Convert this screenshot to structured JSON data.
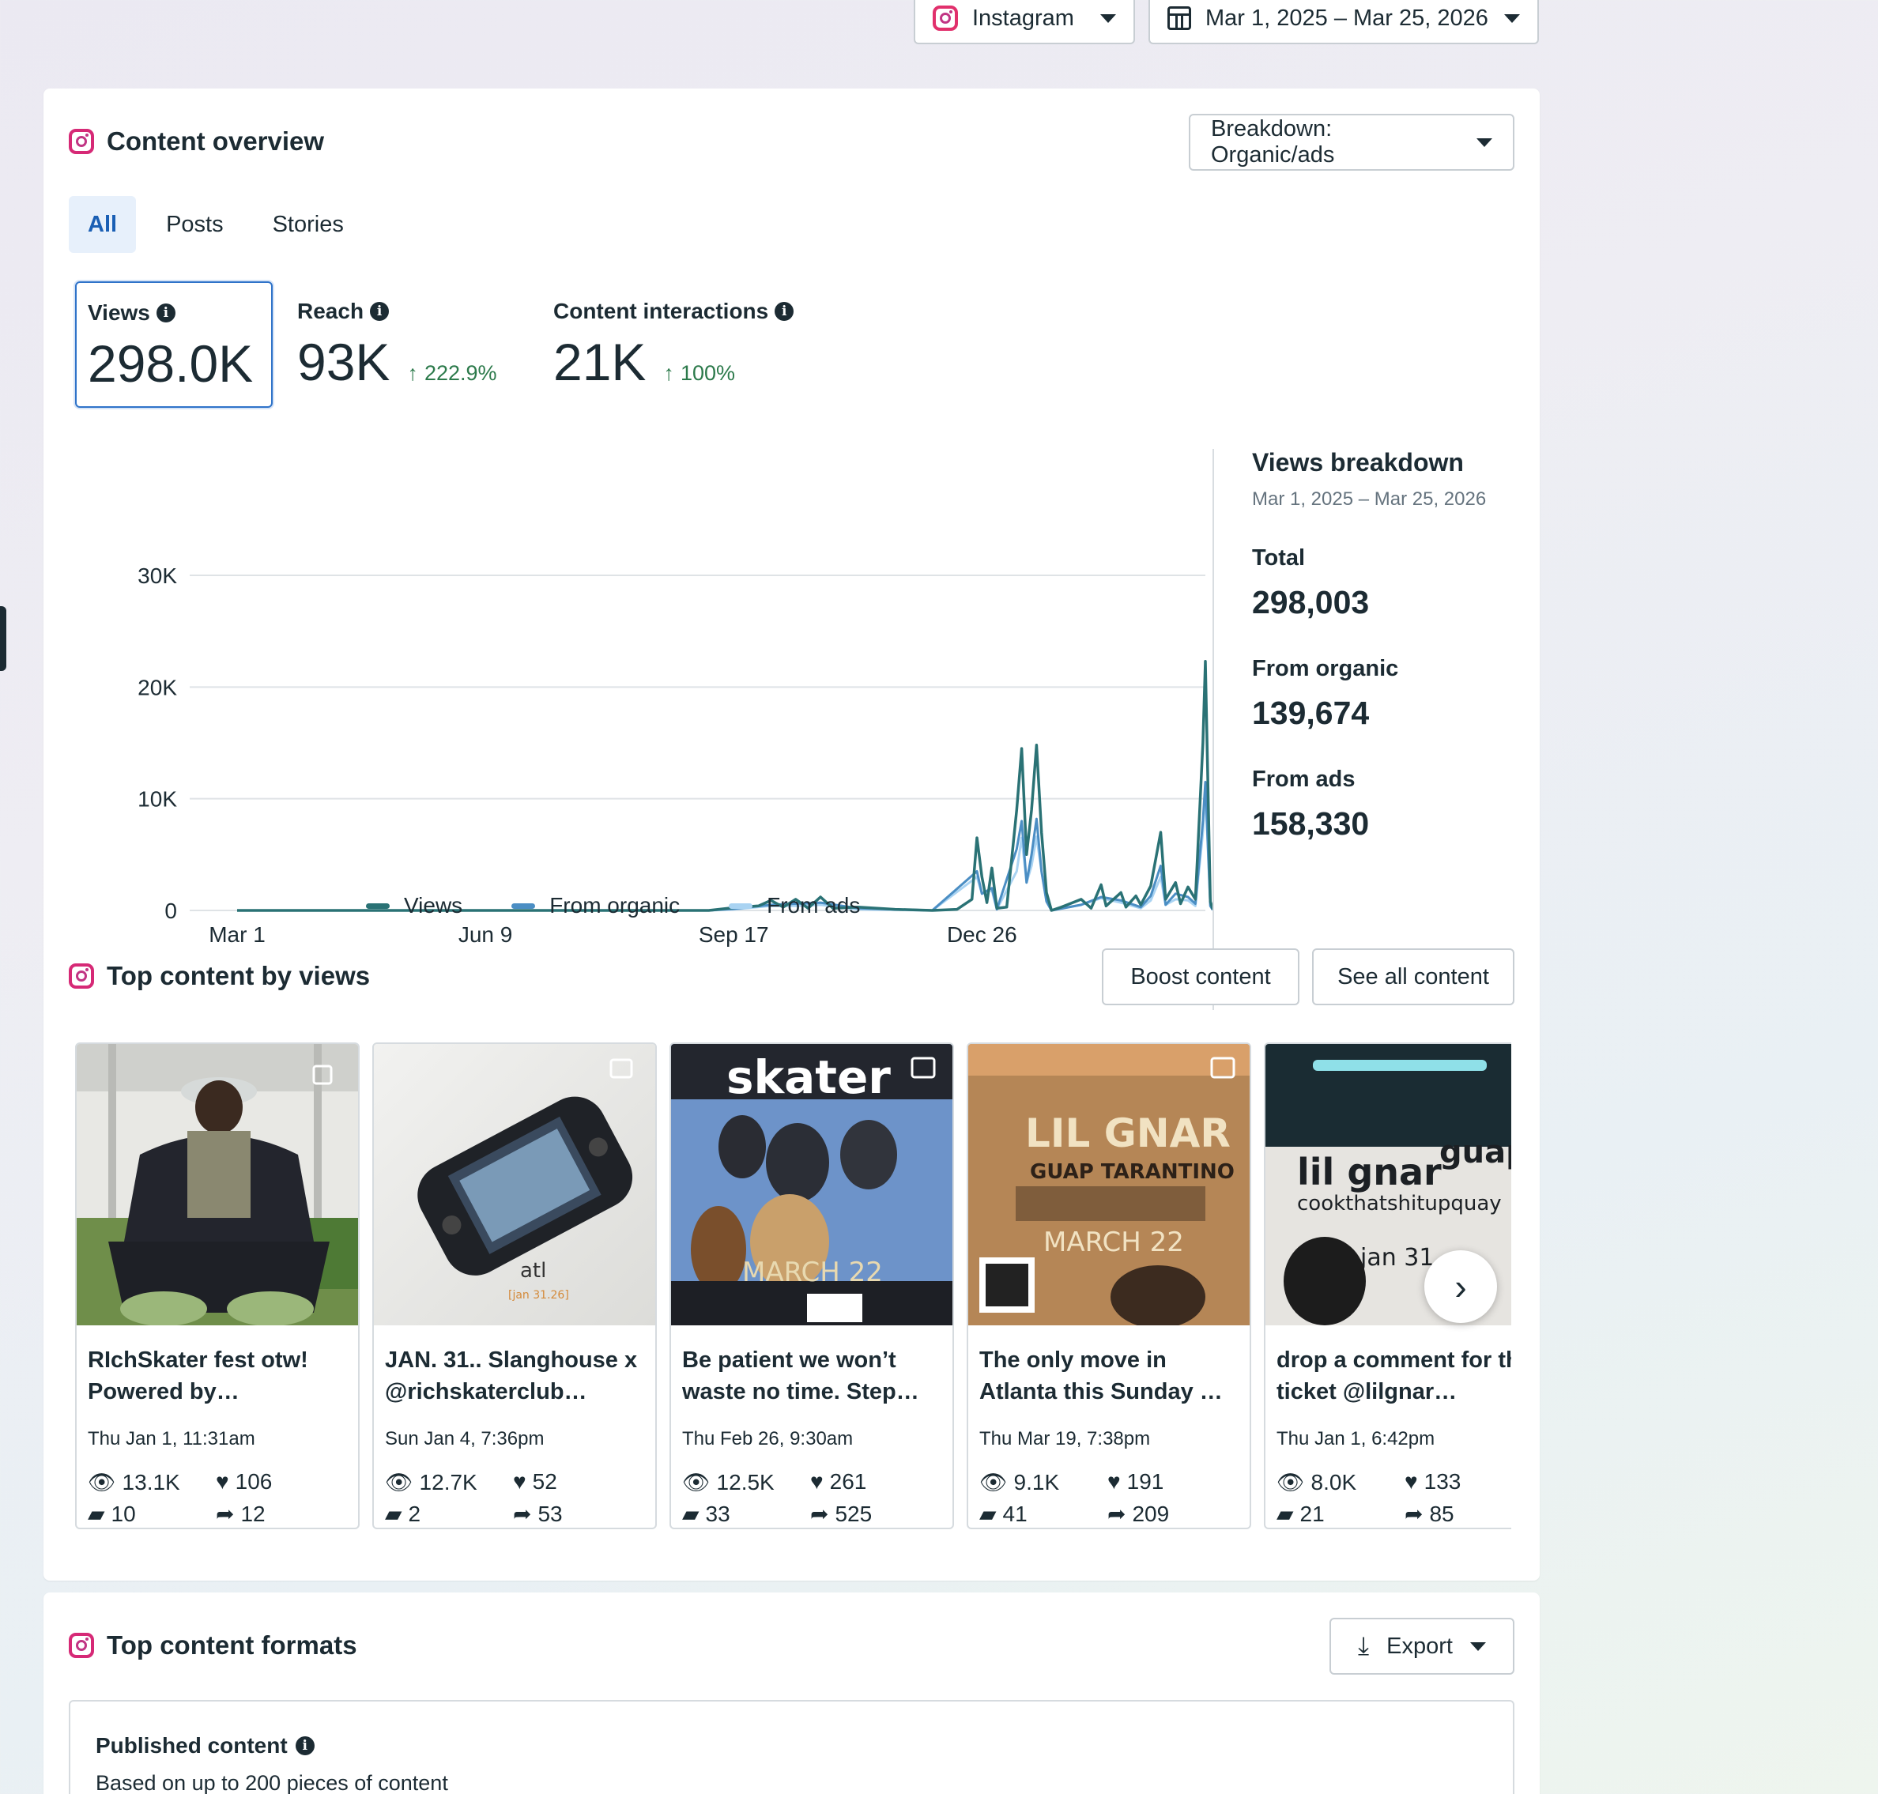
{
  "header": {
    "platform": "Instagram",
    "date_range": "Mar 1, 2025 – Mar 25, 2026"
  },
  "overview": {
    "title": "Content overview",
    "breakdown_button": "Breakdown: Organic/ads",
    "tabs": [
      {
        "label": "All",
        "active": true
      },
      {
        "label": "Posts",
        "active": false
      },
      {
        "label": "Stories",
        "active": false
      }
    ],
    "metrics": [
      {
        "label": "Views",
        "value": "298.0K",
        "delta": ""
      },
      {
        "label": "Reach",
        "value": "93K",
        "delta": "222.9%"
      },
      {
        "label": "Content interactions",
        "value": "21K",
        "delta": "100%"
      }
    ]
  },
  "colors": {
    "views": "#2a7275",
    "organic": "#4b8ec4",
    "ads": "#a9d3f2",
    "accent": "#2f73c9",
    "positive": "#2c7a4b"
  },
  "chart_data": {
    "type": "line",
    "x_ticks": [
      "Mar 1",
      "Jun 9",
      "Sep 17",
      "Dec 26"
    ],
    "y_ticks": [
      "0",
      "10K",
      "20K",
      "30K"
    ],
    "ylim": [
      0,
      30000
    ],
    "xlim": [
      0,
      390
    ],
    "grid": true,
    "legend_position": "bottom",
    "series": [
      {
        "name": "Views",
        "points": [
          [
            0,
            0
          ],
          [
            190,
            0
          ],
          [
            200,
            250
          ],
          [
            210,
            400
          ],
          [
            215,
            900
          ],
          [
            220,
            300
          ],
          [
            225,
            1000
          ],
          [
            230,
            200
          ],
          [
            235,
            1200
          ],
          [
            240,
            200
          ],
          [
            250,
            300
          ],
          [
            265,
            100
          ],
          [
            280,
            0
          ],
          [
            290,
            100
          ],
          [
            296,
            1000
          ],
          [
            298,
            6500
          ],
          [
            300,
            3000
          ],
          [
            302,
            700
          ],
          [
            304,
            3800
          ],
          [
            306,
            200
          ],
          [
            310,
            300
          ],
          [
            314,
            9000
          ],
          [
            316,
            14500
          ],
          [
            318,
            5000
          ],
          [
            320,
            9000
          ],
          [
            322,
            14800
          ],
          [
            324,
            7000
          ],
          [
            326,
            1600
          ],
          [
            328,
            0
          ],
          [
            332,
            300
          ],
          [
            340,
            1000
          ],
          [
            344,
            200
          ],
          [
            348,
            2300
          ],
          [
            350,
            400
          ],
          [
            356,
            1600
          ],
          [
            358,
            300
          ],
          [
            362,
            1300
          ],
          [
            364,
            500
          ],
          [
            368,
            2200
          ],
          [
            372,
            7000
          ],
          [
            374,
            1000
          ],
          [
            378,
            2500
          ],
          [
            380,
            600
          ],
          [
            383,
            2100
          ],
          [
            386,
            1000
          ],
          [
            389,
            15000
          ],
          [
            390,
            22300
          ],
          [
            392,
            800
          ],
          [
            393,
            100
          ]
        ]
      },
      {
        "name": "From organic",
        "points": [
          [
            0,
            0
          ],
          [
            190,
            0
          ],
          [
            200,
            150
          ],
          [
            215,
            500
          ],
          [
            225,
            600
          ],
          [
            235,
            700
          ],
          [
            250,
            200
          ],
          [
            280,
            0
          ],
          [
            298,
            3500
          ],
          [
            300,
            1500
          ],
          [
            304,
            2000
          ],
          [
            306,
            100
          ],
          [
            314,
            5500
          ],
          [
            316,
            8000
          ],
          [
            318,
            2500
          ],
          [
            320,
            5000
          ],
          [
            322,
            8200
          ],
          [
            324,
            3500
          ],
          [
            326,
            800
          ],
          [
            328,
            0
          ],
          [
            340,
            500
          ],
          [
            348,
            1200
          ],
          [
            356,
            900
          ],
          [
            364,
            300
          ],
          [
            368,
            1300
          ],
          [
            372,
            4000
          ],
          [
            374,
            500
          ],
          [
            378,
            1500
          ],
          [
            383,
            1200
          ],
          [
            386,
            600
          ],
          [
            389,
            8000
          ],
          [
            390,
            11500
          ],
          [
            392,
            400
          ],
          [
            393,
            50
          ]
        ]
      },
      {
        "name": "From ads",
        "points": [
          [
            0,
            0
          ],
          [
            190,
            0
          ],
          [
            200,
            100
          ],
          [
            215,
            400
          ],
          [
            225,
            400
          ],
          [
            235,
            500
          ],
          [
            250,
            100
          ],
          [
            280,
            0
          ],
          [
            298,
            3000
          ],
          [
            300,
            1500
          ],
          [
            304,
            1800
          ],
          [
            306,
            100
          ],
          [
            314,
            3500
          ],
          [
            316,
            6500
          ],
          [
            318,
            2500
          ],
          [
            320,
            4000
          ],
          [
            322,
            6600
          ],
          [
            324,
            3500
          ],
          [
            326,
            800
          ],
          [
            328,
            0
          ],
          [
            340,
            500
          ],
          [
            348,
            1100
          ],
          [
            356,
            700
          ],
          [
            364,
            200
          ],
          [
            368,
            900
          ],
          [
            372,
            3000
          ],
          [
            374,
            500
          ],
          [
            378,
            1000
          ],
          [
            383,
            900
          ],
          [
            386,
            400
          ],
          [
            389,
            7000
          ],
          [
            390,
            10800
          ],
          [
            392,
            400
          ],
          [
            393,
            50
          ]
        ]
      }
    ]
  },
  "breakdown": {
    "title": "Views breakdown",
    "range": "Mar 1, 2025 – Mar 25, 2026",
    "total_label": "Total",
    "total": "298,003",
    "organic_label": "From organic",
    "organic": "139,674",
    "ads_label": "From ads",
    "ads": "158,330"
  },
  "top_content": {
    "title": "Top content by views",
    "boost_button": "Boost content",
    "see_all_button": "See all content",
    "posts": [
      {
        "caption": "RIchSkater fest otw! Powered by…",
        "date": "Thu Jan 1, 11:31am",
        "views": "13.1K",
        "likes": "106",
        "comments": "10",
        "shares": "12"
      },
      {
        "caption": "JAN. 31.. Slanghouse x @richskaterclub…",
        "date": "Sun Jan 4, 7:36pm",
        "views": "12.7K",
        "likes": "52",
        "comments": "2",
        "shares": "53"
      },
      {
        "caption": "Be patient we won’t waste no time. Step…",
        "date": "Thu Feb 26, 9:30am",
        "views": "12.5K",
        "likes": "261",
        "comments": "33",
        "shares": "525"
      },
      {
        "caption": "The only move in Atlanta this Sunday …",
        "date": "Thu Mar 19, 7:38pm",
        "views": "9.1K",
        "likes": "191",
        "comments": "41",
        "shares": "209"
      },
      {
        "caption": "drop a comment for th ticket @lilgnar…",
        "date": "Thu Jan 1, 6:42pm",
        "views": "8.0K",
        "likes": "133",
        "comments": "21",
        "shares": "85"
      }
    ]
  },
  "formats": {
    "title": "Top content formats",
    "export_button": "Export",
    "published_title": "Published content",
    "published_sub": "Based on up to 200 pieces of content"
  }
}
